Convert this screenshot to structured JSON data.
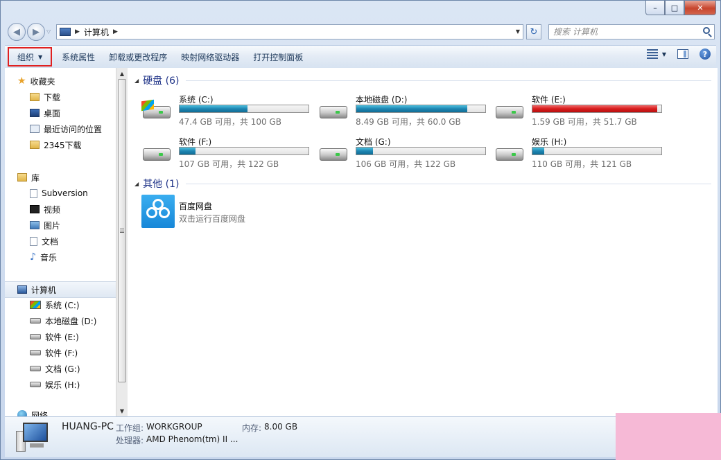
{
  "window": {
    "controls": {
      "minimize": "–",
      "maximize": "□",
      "close": "✕"
    }
  },
  "nav": {
    "back_glyph": "◀",
    "forward_glyph": "▶",
    "dropdown_glyph": "▽",
    "address_path": [
      "计算机"
    ],
    "address_sep": "▶",
    "address_dropdown": "▼",
    "refresh_glyph": "↻",
    "search_placeholder": "搜索 计算机"
  },
  "toolbar": {
    "organize": "组织",
    "items": [
      "系统属性",
      "卸载或更改程序",
      "映射网络驱动器",
      "打开控制面板"
    ],
    "view_caret": "▼",
    "help": "?"
  },
  "sidebar": {
    "favorites": {
      "label": "收藏夹",
      "items": [
        "下载",
        "桌面",
        "最近访问的位置",
        "2345下载"
      ]
    },
    "libraries": {
      "label": "库",
      "items": [
        "Subversion",
        "视频",
        "图片",
        "文档",
        "音乐"
      ]
    },
    "computer": {
      "label": "计算机",
      "items": [
        "系统 (C:)",
        "本地磁盘 (D:)",
        "软件 (E:)",
        "软件 (F:)",
        "文档 (G:)",
        "娱乐 (H:)"
      ]
    },
    "network": {
      "label": "网络"
    }
  },
  "content": {
    "hard_disks": {
      "title": "硬盘 (6)",
      "drives": [
        {
          "name": "系统 (C:)",
          "info": "47.4 GB 可用，共 100 GB",
          "used_fraction": 0.526,
          "color": "#1f86b2",
          "system": true
        },
        {
          "name": "本地磁盘 (D:)",
          "info": "8.49 GB 可用，共 60.0 GB",
          "used_fraction": 0.858,
          "color": "#1f86b2",
          "system": false
        },
        {
          "name": "软件 (E:)",
          "info": "1.59 GB 可用，共 51.7 GB",
          "used_fraction": 0.969,
          "color": "#d81d1d",
          "system": false
        },
        {
          "name": "软件 (F:)",
          "info": "107 GB 可用，共 122 GB",
          "used_fraction": 0.123,
          "color": "#1f86b2",
          "system": false
        },
        {
          "name": "文档 (G:)",
          "info": "106 GB 可用，共 122 GB",
          "used_fraction": 0.131,
          "color": "#1f86b2",
          "system": false
        },
        {
          "name": "娱乐 (H:)",
          "info": "110 GB 可用，共 121 GB",
          "used_fraction": 0.091,
          "color": "#1f86b2",
          "system": false
        }
      ]
    },
    "other": {
      "title": "其他 (1)",
      "items": [
        {
          "name": "百度网盘",
          "desc": "双击运行百度网盘"
        }
      ]
    }
  },
  "details": {
    "name": "HUANG-PC",
    "workgroup_label": "工作组:",
    "workgroup_value": "WORKGROUP",
    "memory_label": "内存:",
    "memory_value": "8.00 GB",
    "processor_label": "处理器:",
    "processor_value": "AMD Phenom(tm) II ..."
  }
}
